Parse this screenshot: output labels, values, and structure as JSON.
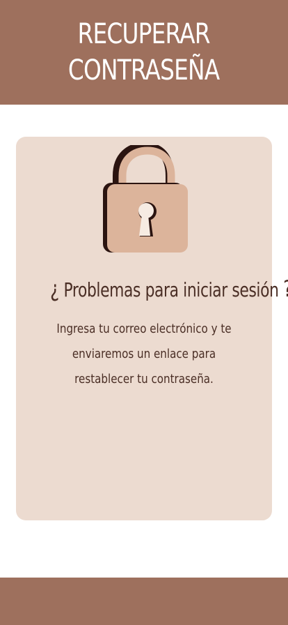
{
  "header": {
    "title_line1": "RECUPERAR",
    "title_line2": "CONTRASEÑA"
  },
  "card": {
    "icon": "lock-icon",
    "question_open": "¿",
    "question_text": "Problemas para iniciar sesión",
    "question_close": "?",
    "description": "Ingresa tu correo electrónico y te enviaremos un enlace para restablecer tu contraseña."
  },
  "colors": {
    "brand": "#9e705d",
    "card_background": "#ecdbd0",
    "text": "#4a2e25",
    "lock_body": "#dcb49b",
    "lock_shadow": "#2b1410"
  }
}
